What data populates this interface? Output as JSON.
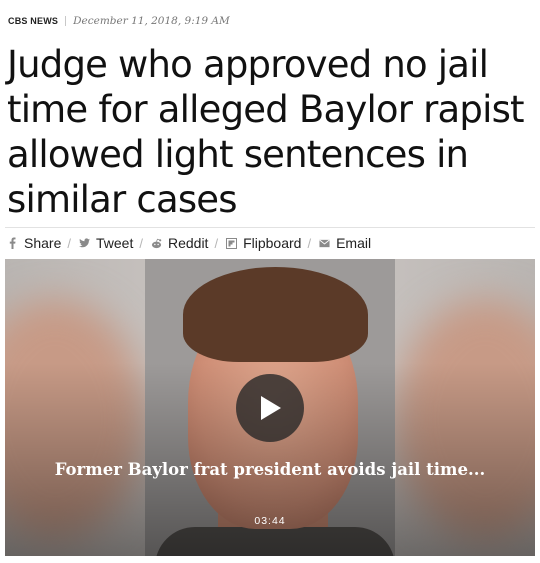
{
  "byline": {
    "source": "CBS NEWS",
    "date": "December 11, 2018, 9:19 AM"
  },
  "headline": "Judge who approved no jail time for alleged Baylor rapist allowed light sentences in similar cases",
  "share": {
    "items": [
      {
        "label": "Share",
        "icon": "facebook-icon"
      },
      {
        "label": "Tweet",
        "icon": "twitter-icon"
      },
      {
        "label": "Reddit",
        "icon": "reddit-icon"
      },
      {
        "label": "Flipboard",
        "icon": "flipboard-icon"
      },
      {
        "label": "Email",
        "icon": "email-icon"
      }
    ],
    "separator": "/"
  },
  "video": {
    "title": "Former Baylor frat president avoids jail time...",
    "duration": "03:44"
  }
}
